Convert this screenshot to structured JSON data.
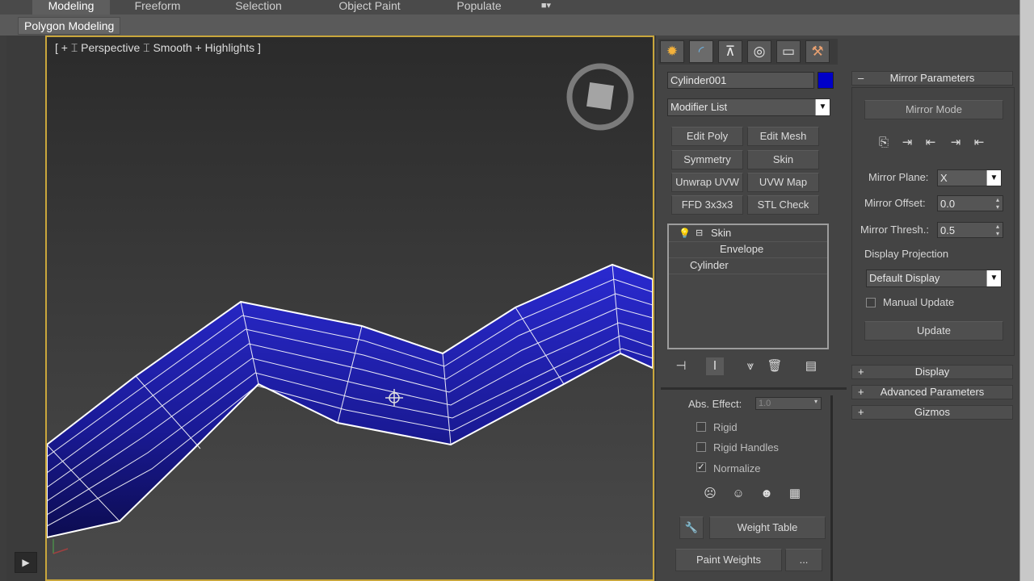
{
  "ribbon": {
    "tabs": [
      "Modeling",
      "Freeform",
      "Selection",
      "Object Paint",
      "Populate"
    ],
    "active_tab": "Modeling",
    "group_label": "Polygon Modeling"
  },
  "viewport": {
    "label": "[ + ][ Perspective ][ Smooth + Highlights ]",
    "label_display": "[ + ⌶ Perspective ⌶ Smooth + Highlights ]",
    "mesh_color": "#1d1d9e",
    "border_color": "#c9a63c"
  },
  "command_panel": {
    "tabs": [
      "create-icon",
      "modify-icon",
      "hierarchy-icon",
      "motion-icon",
      "display-icon",
      "utilities-icon"
    ],
    "object_name": "Cylinder001",
    "object_color": "#0000c8",
    "modifier_list": "Modifier List",
    "modifier_buttons": [
      "Edit Poly",
      "Edit Mesh",
      "Symmetry",
      "Skin",
      "Unwrap UVW",
      "UVW Map",
      "FFD 3x3x3",
      "STL Check"
    ],
    "stack": {
      "skin": "Skin",
      "envelope": "Envelope",
      "cylinder": "Cylinder"
    },
    "abs_effect_label": "Abs. Effect:",
    "abs_effect_value": "1.0",
    "rigid": "Rigid",
    "rigid_handles": "Rigid Handles",
    "normalize": "Normalize",
    "normalize_checked": true,
    "weight_table": "Weight Table",
    "paint_weights": "Paint Weights",
    "ellipsis": "..."
  },
  "mirror": {
    "title": "Mirror Parameters",
    "mirror_mode": "Mirror Mode",
    "mirror_plane_label": "Mirror Plane:",
    "mirror_plane_value": "X",
    "mirror_offset_label": "Mirror Offset:",
    "mirror_offset_value": "0.0",
    "mirror_thresh_label": "Mirror Thresh.:",
    "mirror_thresh_value": "0.5",
    "display_projection_label": "Display Projection",
    "display_projection_value": "Default Display",
    "manual_update": "Manual Update",
    "update": "Update"
  },
  "rollouts": [
    "Display",
    "Advanced Parameters",
    "Gizmos"
  ]
}
